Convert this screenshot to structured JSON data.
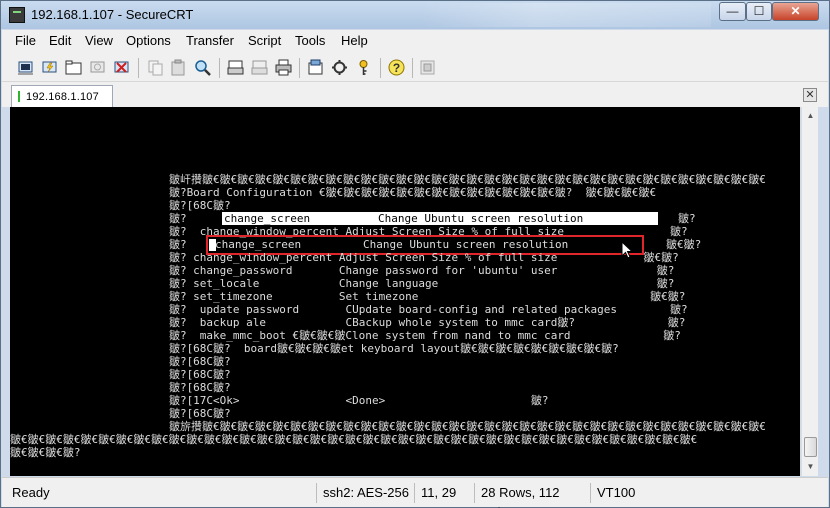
{
  "window": {
    "title": "192.168.1.107 - SecureCRT",
    "buttons": {
      "minimize": "—",
      "maximize": "☐",
      "close": "✕"
    }
  },
  "menu": {
    "items": [
      "File",
      "Edit",
      "View",
      "Options",
      "Transfer",
      "Script",
      "Tools",
      "Help"
    ]
  },
  "toolbar": {
    "icons": [
      "connect-icon",
      "quick-connect-icon",
      "connect-in-tab-icon",
      "reconnect-icon",
      "disconnect-icon",
      "copy-icon",
      "paste-icon",
      "find-icon",
      "print-screen-icon",
      "print-setup-icon",
      "print-icon",
      "session-options-icon",
      "global-options-icon",
      "keymap-icon",
      "help-icon",
      "sftp-icon"
    ]
  },
  "tabs": [
    {
      "label": "192.168.1.107",
      "active": true
    }
  ],
  "terminal": {
    "lines": [
      "                        皺屽攢皺€皺€皺€皺€皺€皺€皺€皺€皺€皺€皺€皺€皺€皺€皺€皺€皺€皺€皺€皺€皺€皺€皺€皺€皺€皺€皺€皺€皺€皺€皺€皺€",
      "                        皺?Board Configuration €皺€皺€皺€皺€皺€皺€皺€皺€皺€皺€皺€皺€皺€皺?  皺€皺€皺€皺€",
      "                        皺?[68C皺?",
      "                        皺?  change_screen         Change Ubuntu screen resolution                  皺?",
      "                        皺?  change_window_percent Adjust Screen Size % of full size                皺?",
      "                        皺? change_screen         Change Ubuntu screen resolution               皺€皺?",
      "                        皺? change_window_percent Adjust Screen Size % of full size             皺€皺?",
      "                        皺? change_password       Change password for 'ubuntu' user               皺?",
      "                        皺? set_locale            Change language                                 皺?",
      "                        皺? set_timezone          Set timezone                                   皺€皺?",
      "                        皺?  update password       CUpdate board-config and related packages        皺?",
      "                        皺?  backup ale            CBackup whole system to mmc card皺?              皺?",
      "                        皺?  make_mmc_boot €皺€皺€皺Clone system from nand to mmc card              皺?",
      "                        皺?[68C皺?  board皺€皺€皺€皺et keyboard layout皺€皺€皺€皺€皺€皺€皺€皺€皺?",
      "                        皺?[68C皺?",
      "                        皺?[68C皺?",
      "                        皺?[68C皺?",
      "                        皺?[17C<Ok>                <Done>                      皺?",
      "                        皺?[68C皺?",
      "                        皺旂攢皺€皺€皺€皺€皺€皺€皺€皺€皺€皺€皺€皺€皺€皺€皺€皺€皺€皺€皺€皺€皺€皺€皺€皺€皺€皺€皺€皺€皺€皺€皺€皺€",
      "皺€皺€皺€皺€皺€皺€皺€皺€皺€皺€皺€皺€皺€皺€皺€皺€皺€皺€皺€皺€皺€皺€皺€皺€皺€皺€皺€皺€皺€皺€皺€皺€皺€皺€皺€皺€皺€皺€皺€",
      "皺€皺€皺€皺?"
    ],
    "highlight_row": {
      "name": "change_screen",
      "description": "Change Ubuntu screen resolution"
    },
    "boxed_row": {
      "name": "change_screen",
      "description": "Change Ubuntu screen resolution"
    }
  },
  "status": {
    "state": "Ready",
    "encryption": "ssh2: AES-256",
    "cursor_pos": "11,  29",
    "dimensions": "28 Rows, 112 Cols",
    "emulation": "VT100"
  }
}
